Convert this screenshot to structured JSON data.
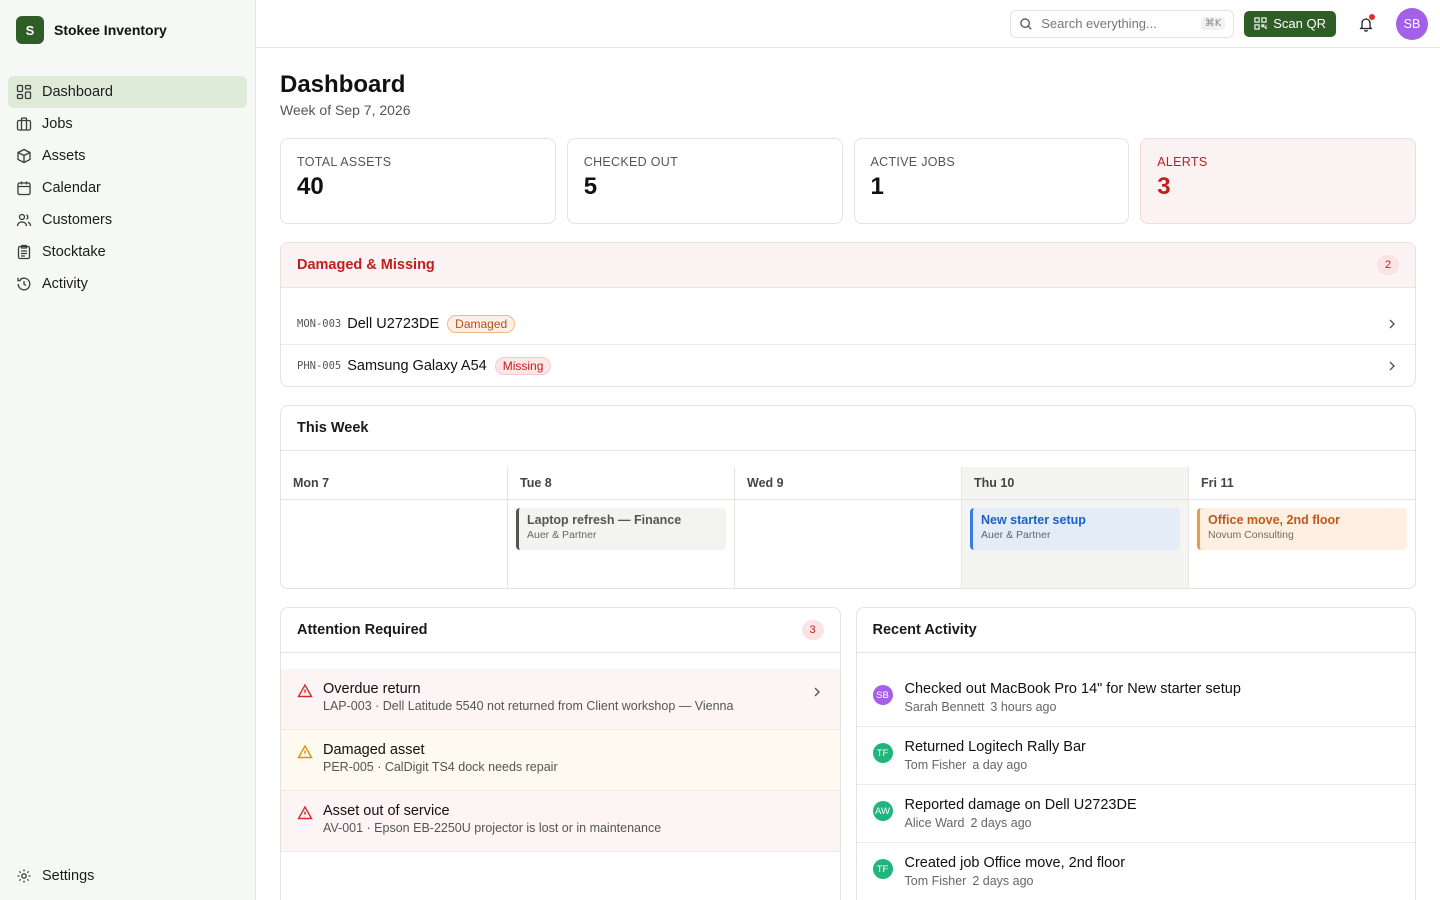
{
  "brand": {
    "logo_letter": "S",
    "name": "Stokee Inventory"
  },
  "sidebar": {
    "items": [
      {
        "label": "Dashboard",
        "icon": "dashboard-icon",
        "active": true
      },
      {
        "label": "Jobs",
        "icon": "briefcase-icon"
      },
      {
        "label": "Assets",
        "icon": "box-icon"
      },
      {
        "label": "Calendar",
        "icon": "calendar-icon"
      },
      {
        "label": "Customers",
        "icon": "users-icon"
      },
      {
        "label": "Stocktake",
        "icon": "clipboard-icon"
      },
      {
        "label": "Activity",
        "icon": "history-icon"
      }
    ],
    "settings_label": "Settings"
  },
  "topbar": {
    "search_placeholder": "Search everything...",
    "shortcut": "⌘K",
    "scan_label": "Scan QR",
    "user_initials": "SB",
    "colors": {
      "accent": "#2f5d26",
      "avatar": "#a461e8",
      "notification_dot": "#e03131"
    }
  },
  "page": {
    "title": "Dashboard",
    "subtitle": "Week of Sep 7, 2026"
  },
  "stats": [
    {
      "label": "TOTAL ASSETS",
      "value": "40"
    },
    {
      "label": "CHECKED OUT",
      "value": "5"
    },
    {
      "label": "ACTIVE JOBS",
      "value": "1"
    },
    {
      "label": "ALERTS",
      "value": "3"
    }
  ],
  "damaged_missing": {
    "title": "Damaged & Missing",
    "count": "2",
    "items": [
      {
        "code": "MON-003",
        "name": "Dell U2723DE",
        "status": "Damaged"
      },
      {
        "code": "PHN-005",
        "name": "Samsung Galaxy A54",
        "status": "Missing"
      }
    ]
  },
  "week": {
    "title": "This Week",
    "days": [
      {
        "label": "Mon 7"
      },
      {
        "label": "Tue 8",
        "event": {
          "title": "Laptop refresh — Finance",
          "customer": "Auer & Partner"
        }
      },
      {
        "label": "Wed 9"
      },
      {
        "label": "Thu 10",
        "today": true,
        "event": {
          "title": "New starter setup",
          "customer": "Auer & Partner"
        }
      },
      {
        "label": "Fri 11",
        "event": {
          "title": "Office move, 2nd floor",
          "customer": "Novum Consulting"
        }
      }
    ]
  },
  "attention": {
    "title": "Attention Required",
    "count": "3",
    "items": [
      {
        "title": "Overdue return",
        "detail": "LAP-003 · Dell Latitude 5540 not returned from Client workshop — Vienna",
        "severity": "red"
      },
      {
        "title": "Damaged asset",
        "detail": "PER-005 · CalDigit TS4 dock needs repair",
        "severity": "amber"
      },
      {
        "title": "Asset out of service",
        "detail": "AV-001 · Epson EB-2250U projector is lost or in maintenance",
        "severity": "red"
      }
    ]
  },
  "activity": {
    "title": "Recent Activity",
    "items": [
      {
        "initials": "SB",
        "color": "#a461e8",
        "text": "Checked out MacBook Pro 14\" for New starter setup",
        "user": "Sarah Bennett",
        "time": "3 hours ago"
      },
      {
        "initials": "TF",
        "color": "#1fb57c",
        "text": "Returned Logitech Rally Bar",
        "user": "Tom Fisher",
        "time": "a day ago"
      },
      {
        "initials": "AW",
        "color": "#1fb57c",
        "text": "Reported damage on Dell U2723DE",
        "user": "Alice Ward",
        "time": "2 days ago"
      },
      {
        "initials": "TF",
        "color": "#1fb57c",
        "text": "Created job Office move, 2nd floor",
        "user": "Tom Fisher",
        "time": "2 days ago"
      }
    ]
  }
}
